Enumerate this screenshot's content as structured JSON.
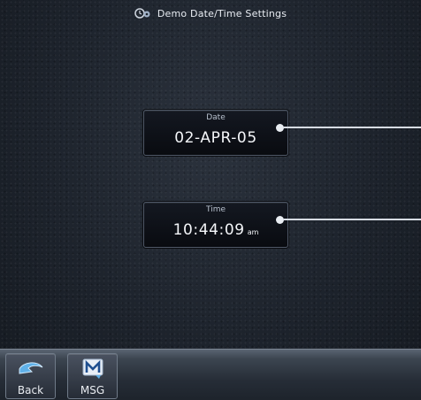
{
  "header": {
    "title": "Demo Date/Time Settings",
    "icon": "clock-gear-icon"
  },
  "fields": {
    "date": {
      "label": "Date",
      "value": "02-APR-05"
    },
    "time": {
      "label": "Time",
      "value": "10:44:09",
      "suffix": "am"
    }
  },
  "bottom_nav": {
    "back": {
      "label": "Back",
      "icon": "back-arrow-icon"
    },
    "msg": {
      "label": "MSG",
      "icon": "message-m-icon"
    }
  },
  "colors": {
    "background": "#1d232c",
    "button_face": "#0c0f15",
    "text": "#f4f6f9",
    "callout": "#e9edf2"
  }
}
